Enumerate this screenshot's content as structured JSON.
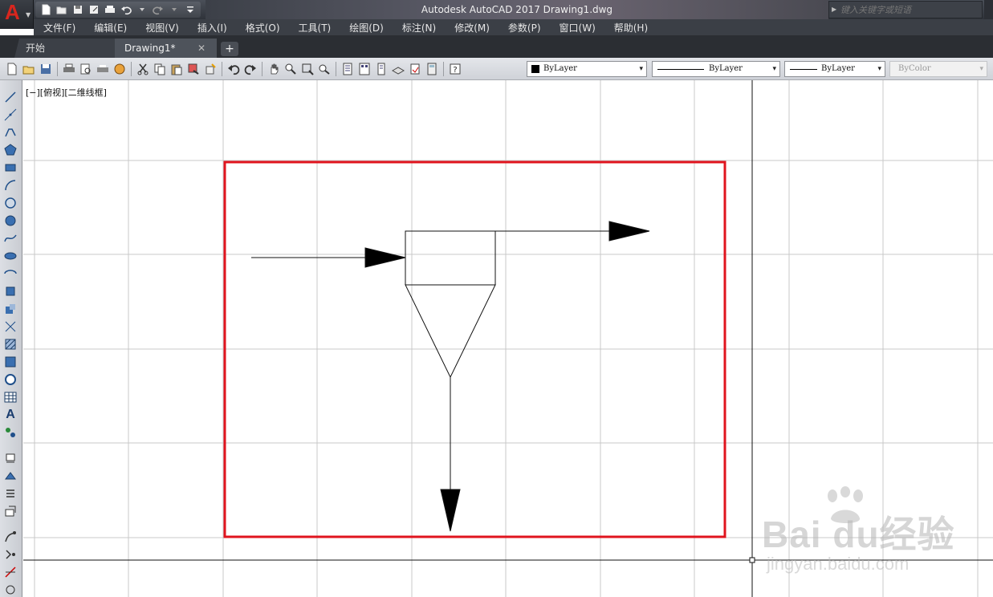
{
  "window": {
    "title": "Autodesk AutoCAD 2017    Drawing1.dwg",
    "search_placeholder": "键入关键字或短语"
  },
  "menu": {
    "items": [
      "文件(F)",
      "编辑(E)",
      "视图(V)",
      "插入(I)",
      "格式(O)",
      "工具(T)",
      "绘图(D)",
      "标注(N)",
      "修改(M)",
      "参数(P)",
      "窗口(W)",
      "帮助(H)"
    ]
  },
  "tabs": {
    "start": "开始",
    "drawing": "Drawing1*",
    "close": "✕",
    "add": "+"
  },
  "properties": {
    "color": "ByLayer",
    "linetype": "ByLayer",
    "lineweight": "ByLayer",
    "plotstyle": "ByColor",
    "arrow": "▾"
  },
  "canvas": {
    "viewport_label": "[−][俯视][二维线框]",
    "highlight_color": "#e0141e"
  },
  "draw_tools": {
    "text_tool": "A"
  },
  "watermark": {
    "brand": "Bai du经验",
    "url": "jingyan.baidu.com"
  },
  "colors": {
    "titlebar": "#3b3f46",
    "accent_red": "#d8261e"
  }
}
